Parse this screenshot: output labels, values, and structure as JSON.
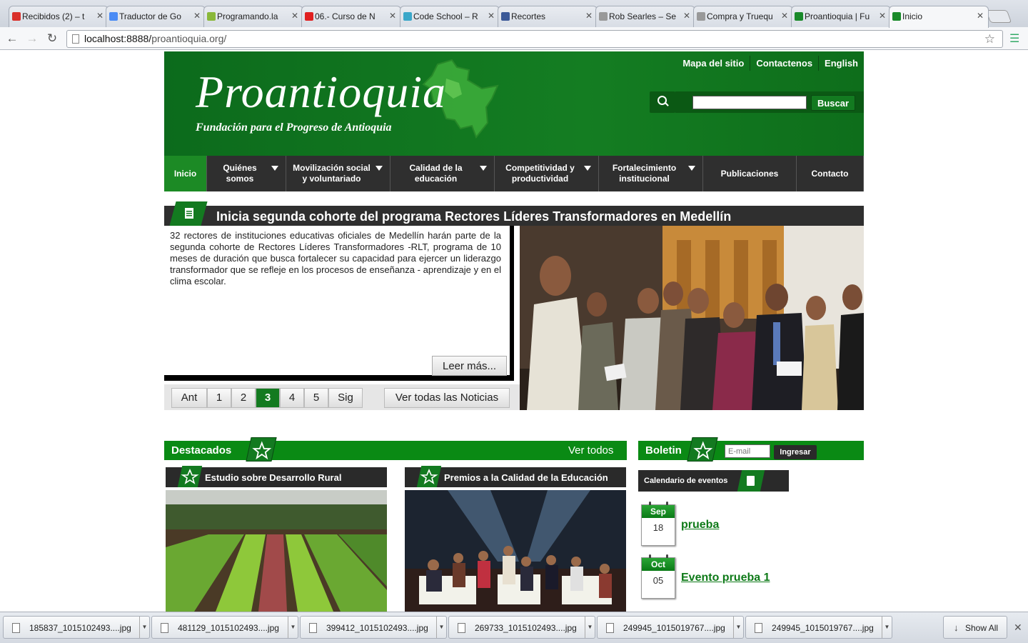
{
  "browser": {
    "tabs": [
      {
        "title": "Recibidos (2) – t",
        "color": "#d9302b"
      },
      {
        "title": "Traductor de Go",
        "color": "#4a8bf5"
      },
      {
        "title": "Programando.la",
        "color": "#8ab83a"
      },
      {
        "title": "06.- Curso de N",
        "color": "#e02020"
      },
      {
        "title": "Code School – R",
        "color": "#3ba7c9"
      },
      {
        "title": "Recortes",
        "color": "#3b5998"
      },
      {
        "title": "Rob Searles – Se",
        "color": "#999999"
      },
      {
        "title": "Compra y Truequ",
        "color": "#999999"
      },
      {
        "title": "Proantioquia | Fu",
        "color": "#1a8a2a"
      },
      {
        "title": "Inicio",
        "color": "#1a8a2a"
      }
    ],
    "url_host": "localhost:8888/",
    "url_path": "proantioquia.org/"
  },
  "header": {
    "logo": "Proantioquia",
    "tagline": "Fundación para el Progreso de Antioquia",
    "links": [
      "Mapa del sitio",
      "Contactenos",
      "English"
    ],
    "search_button": "Buscar"
  },
  "nav": [
    {
      "label": "Inicio",
      "active": true,
      "drop": false
    },
    {
      "label": "Quiénes somos",
      "active": false,
      "drop": true
    },
    {
      "label": "Movilización social y voluntariado",
      "active": false,
      "drop": true
    },
    {
      "label": "Calidad de la educación",
      "active": false,
      "drop": true
    },
    {
      "label": "Competitividad y productividad",
      "active": false,
      "drop": true
    },
    {
      "label": "Fortalecimiento institucional",
      "active": false,
      "drop": true
    },
    {
      "label": "Publicaciones",
      "active": false,
      "drop": false
    },
    {
      "label": "Contacto",
      "active": false,
      "drop": false
    }
  ],
  "news": {
    "title": "Inicia segunda cohorte del programa Rectores Líderes Transformadores en Medellín",
    "body": "32 rectores de instituciones educativas oficiales de Medellín harán parte de la segunda cohorte de Rectores Líderes Transformadores -RLT, programa de 10 meses de duración que busca fortalecer su capacidad para ejercer un liderazgo transformador que se refleje en los procesos de enseñanza - aprendizaje y en el clima escolar.",
    "read_more": "Leer más...",
    "pager": [
      "Ant",
      "1",
      "2",
      "3",
      "4",
      "5",
      "Sig"
    ],
    "current_page": "3",
    "all_news": "Ver todas las Noticias"
  },
  "featured": {
    "title": "Destacados",
    "view_all": "Ver todos",
    "items": [
      {
        "title": "Estudio sobre Desarrollo Rural"
      },
      {
        "title": "Premios a la Calidad de la Educación"
      }
    ]
  },
  "newsletter": {
    "title": "Boletin",
    "placeholder": "E-mail",
    "button": "Ingresar"
  },
  "calendar": {
    "title": "Calendario de eventos",
    "events": [
      {
        "month": "Sep",
        "day": "18",
        "name": "prueba"
      },
      {
        "month": "Oct",
        "day": "05",
        "name": "Evento prueba 1"
      }
    ]
  },
  "downloads": {
    "files": [
      "185837_1015102493....jpg",
      "481129_1015102493....jpg",
      "399412_1015102493....jpg",
      "269733_1015102493....jpg",
      "249945_1015019767....jpg",
      "249945_1015019767....jpg"
    ],
    "show_all": "Show All"
  }
}
